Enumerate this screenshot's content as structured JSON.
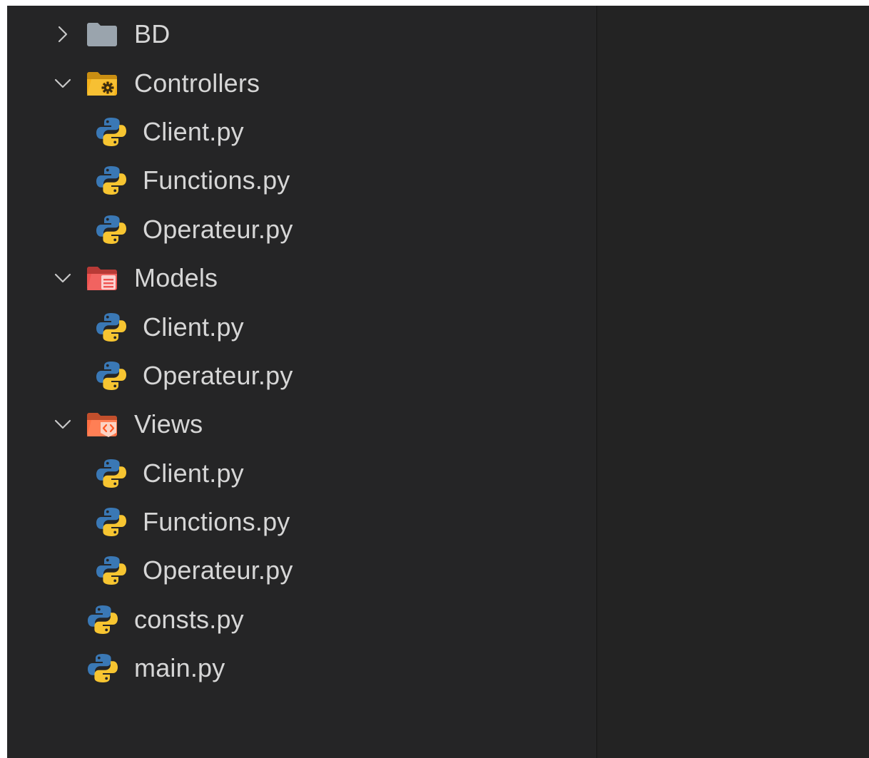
{
  "explorer": {
    "items": [
      {
        "label": "BD",
        "kind": "folder",
        "expanded": false,
        "icon": "folder-icon",
        "color": "#9aa4ad"
      },
      {
        "label": "Controllers",
        "kind": "folder",
        "expanded": true,
        "icon": "folder-controllers-icon",
        "color": "#f5b21b",
        "children": [
          {
            "label": "Client.py",
            "icon": "python-icon"
          },
          {
            "label": "Functions.py",
            "icon": "python-icon"
          },
          {
            "label": "Operateur.py",
            "icon": "python-icon"
          }
        ]
      },
      {
        "label": "Models",
        "kind": "folder",
        "expanded": true,
        "icon": "folder-models-icon",
        "color": "#ef5350",
        "children": [
          {
            "label": "Client.py",
            "icon": "python-icon"
          },
          {
            "label": "Operateur.py",
            "icon": "python-icon"
          }
        ]
      },
      {
        "label": "Views",
        "kind": "folder",
        "expanded": true,
        "icon": "folder-views-icon",
        "color": "#ff7043",
        "children": [
          {
            "label": "Client.py",
            "icon": "python-icon"
          },
          {
            "label": "Functions.py",
            "icon": "python-icon"
          },
          {
            "label": "Operateur.py",
            "icon": "python-icon"
          }
        ]
      },
      {
        "label": "consts.py",
        "kind": "file",
        "icon": "python-icon"
      },
      {
        "label": "main.py",
        "kind": "file",
        "icon": "python-icon"
      }
    ]
  },
  "colors": {
    "background": "#252526",
    "text": "#d6d6d6",
    "python_blue": "#3a78b5",
    "python_yellow": "#f7c531"
  }
}
